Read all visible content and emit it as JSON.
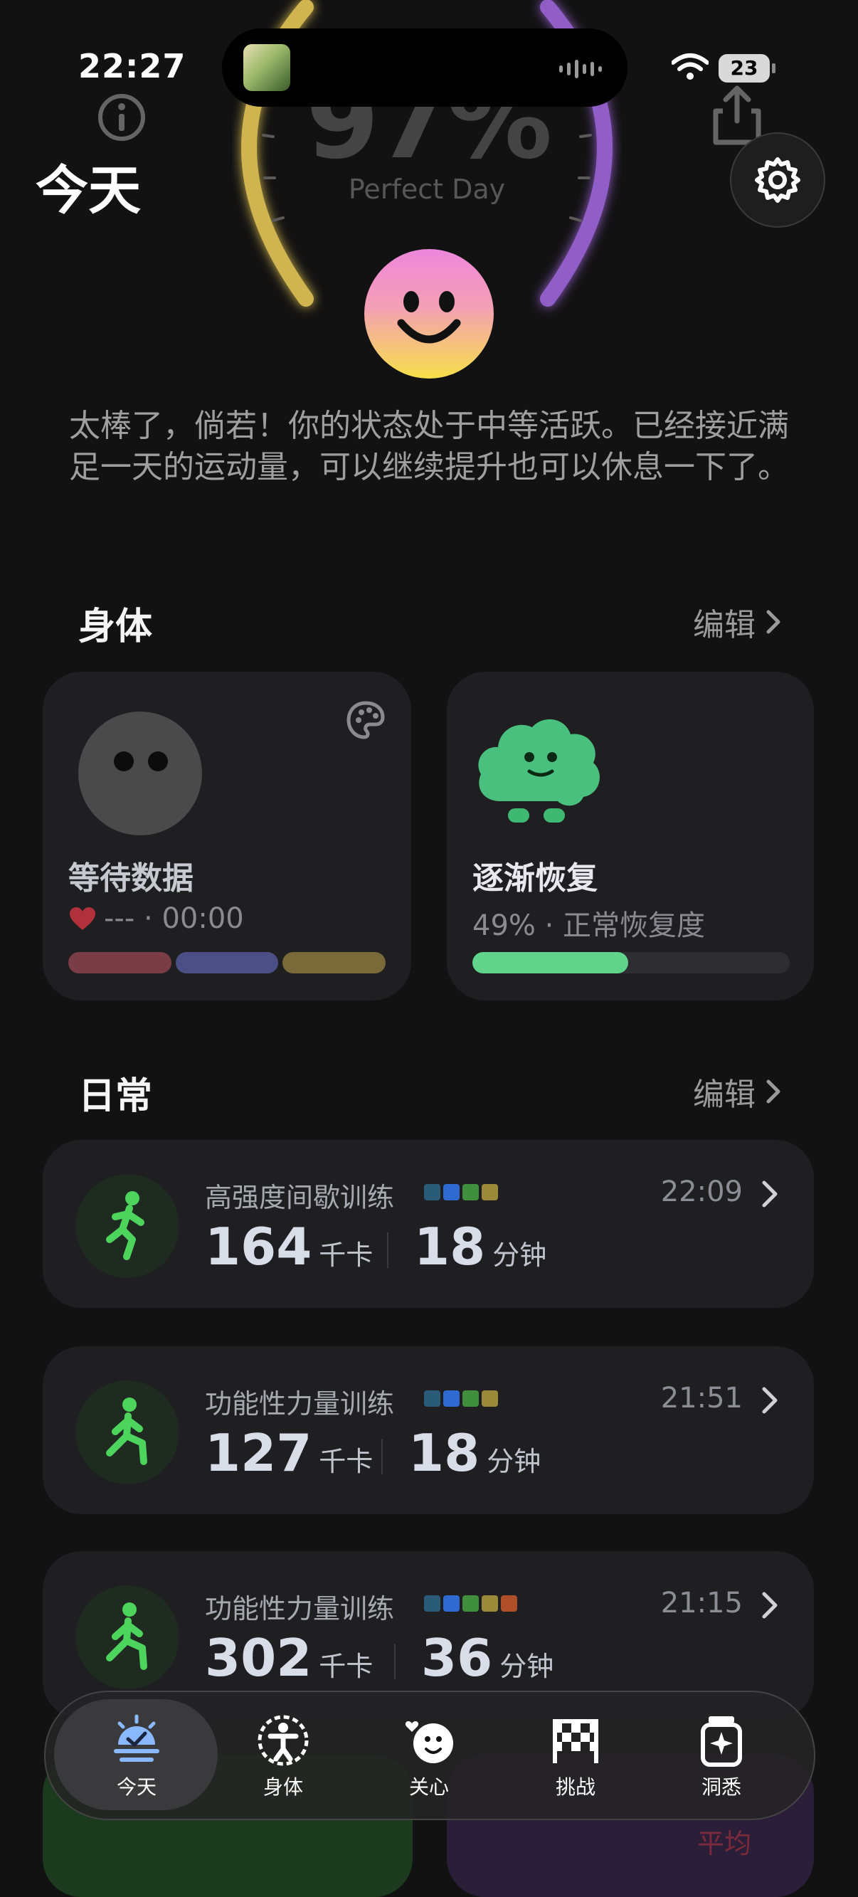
{
  "status_bar": {
    "time": "22:27",
    "battery": "23"
  },
  "header": {
    "title": "今天"
  },
  "gauge": {
    "percent_text": "97%",
    "caption": "Perfect Day",
    "left_color": "#f2d15a",
    "right_color": "#a86ce8"
  },
  "summary": "太棒了，倘若！你的状态处于中等活跃。已经接近满足一天的运动量，可以继续提升也可以休息一下了。",
  "body_section": {
    "title": "身体",
    "edit_label": "编辑",
    "left_card": {
      "title": "等待数据",
      "sub": "--- · 00:00",
      "bar_colors": [
        "#7a3c46",
        "#4b4f86",
        "#7a6a3a"
      ]
    },
    "right_card": {
      "title": "逐渐恢复",
      "sub": "49% · 正常恢复度",
      "progress": 0.49,
      "progress_color": "#5fd48a"
    }
  },
  "daily_section": {
    "title": "日常",
    "edit_label": "编辑",
    "activities": [
      {
        "name": "高强度间歇训练",
        "time": "22:09",
        "kcal": "164",
        "kcal_unit": "千卡",
        "mins": "18",
        "mins_unit": "分钟",
        "dots": [
          "#2a5c78",
          "#2f6ad0",
          "#3f8f3f",
          "#9a8a3a"
        ]
      },
      {
        "name": "功能性力量训练",
        "time": "21:51",
        "kcal": "127",
        "kcal_unit": "千卡",
        "mins": "18",
        "mins_unit": "分钟",
        "dots": [
          "#2a5c78",
          "#2f6ad0",
          "#3f8f3f",
          "#9a8a3a"
        ]
      },
      {
        "name": "功能性力量训练",
        "time": "21:15",
        "kcal": "302",
        "kcal_unit": "千卡",
        "mins": "36",
        "mins_unit": "分钟",
        "dots": [
          "#2a5c78",
          "#2f6ad0",
          "#3f8f3f",
          "#9a8a3a",
          "#b0502a"
        ]
      }
    ]
  },
  "peek": {
    "avg_label": "平均"
  },
  "tabs": [
    {
      "label": "今天",
      "active": true
    },
    {
      "label": "身体",
      "active": false
    },
    {
      "label": "关心",
      "active": false
    },
    {
      "label": "挑战",
      "active": false
    },
    {
      "label": "洞悉",
      "active": false
    }
  ]
}
